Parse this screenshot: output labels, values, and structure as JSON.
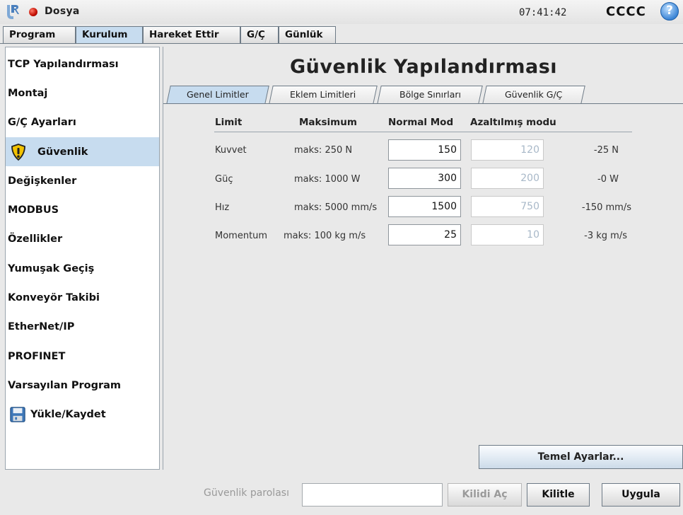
{
  "header": {
    "menu_label": "Dosya",
    "time": "07:41:42",
    "robot_name": "CCCC",
    "help_symbol": "?"
  },
  "main_tabs": [
    "Program",
    "Kurulum",
    "Hareket Ettir",
    "G/Ç",
    "Günlük"
  ],
  "active_main_tab": "Kurulum",
  "sidebar": {
    "items": [
      {
        "label": "TCP Yapılandırması",
        "icon": null
      },
      {
        "label": "Montaj",
        "icon": null
      },
      {
        "label": "G/Ç Ayarları",
        "icon": null
      },
      {
        "label": "Güvenlik",
        "icon": "warning-shield-icon"
      },
      {
        "label": "Değişkenler",
        "icon": null
      },
      {
        "label": "MODBUS",
        "icon": null
      },
      {
        "label": "Özellikler",
        "icon": null
      },
      {
        "label": "Yumuşak Geçiş",
        "icon": null
      },
      {
        "label": "Konveyör Takibi",
        "icon": null
      },
      {
        "label": "EtherNet/IP",
        "icon": null
      },
      {
        "label": "PROFINET",
        "icon": null
      },
      {
        "label": "Varsayılan Program",
        "icon": null
      },
      {
        "label": "Yükle/Kaydet",
        "icon": "floppy-disk-icon"
      }
    ],
    "active": "Güvenlik"
  },
  "content": {
    "title": "Güvenlik Yapılandırması",
    "subtabs": [
      "Genel Limitler",
      "Eklem Limitleri",
      "Bölge Sınırları",
      "Güvenlik G/Ç"
    ],
    "active_subtab": "Genel Limitler",
    "table": {
      "headers": [
        "Limit",
        "Maksimum",
        "Normal Mod",
        "Azaltılmış modu"
      ],
      "rows": [
        {
          "limit": "Kuvvet",
          "max": "maks: 250 N",
          "normal": "150",
          "reduced": "120",
          "delta": "-25 N"
        },
        {
          "limit": "Güç",
          "max": "maks: 1000 W",
          "normal": "300",
          "reduced": "200",
          "delta": "-0 W"
        },
        {
          "limit": "Hız",
          "max": "maks: 5000 mm/s",
          "normal": "1500",
          "reduced": "750",
          "delta": "-150 mm/s"
        },
        {
          "limit": "Momentum",
          "max": "maks: 100 kg m/s",
          "normal": "25",
          "reduced": "10",
          "delta": "-3 kg m/s"
        }
      ]
    },
    "basic_settings_label": "Temel Ayarlar..."
  },
  "footer": {
    "password_label": "Güvenlik parolası",
    "password_value": "",
    "unlock_label": "Kilidi Aç",
    "lock_label": "Kilitle",
    "apply_label": "Uygula"
  },
  "colors": {
    "active_tab": "#c7dcef",
    "disabled_text": "#a8b8c8",
    "status_led": "#c10d00",
    "warning_icon": "#f2c200"
  }
}
